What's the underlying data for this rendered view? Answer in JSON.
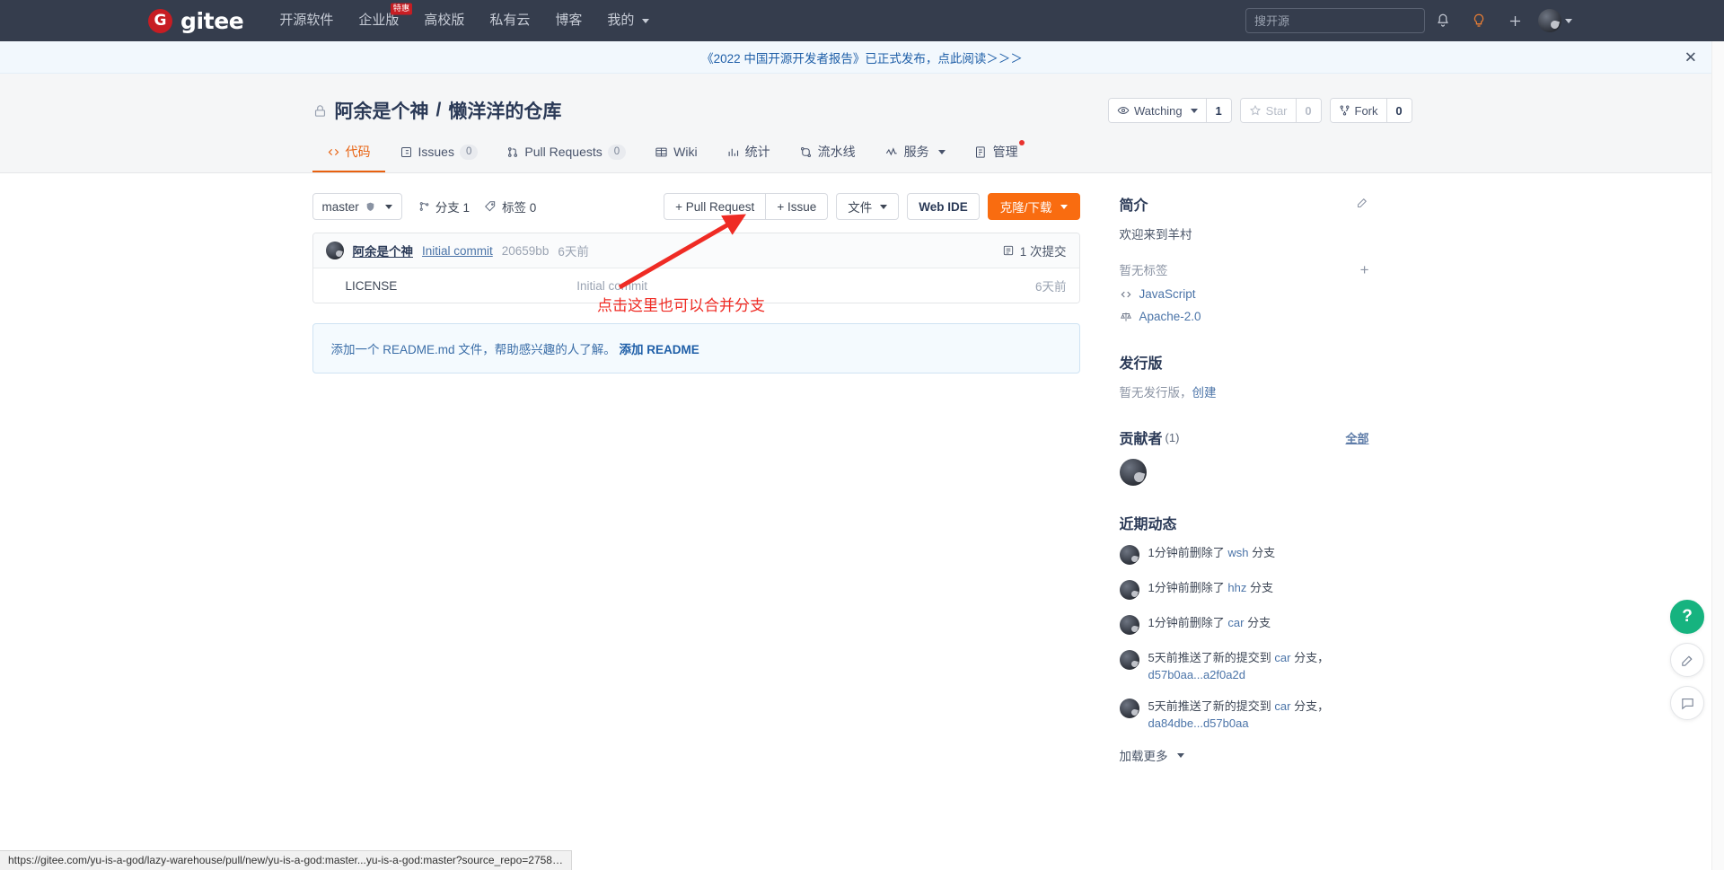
{
  "topnav": {
    "brand": "gitee",
    "logo_letter": "G",
    "links": [
      {
        "label": "开源软件",
        "badge": null
      },
      {
        "label": "企业版",
        "badge": "特惠"
      },
      {
        "label": "高校版",
        "badge": null
      },
      {
        "label": "私有云",
        "badge": null
      },
      {
        "label": "博客",
        "badge": null
      },
      {
        "label": "我的",
        "badge": null,
        "caret": true
      }
    ],
    "search_placeholder": "搜开源",
    "icons": [
      "bell-icon",
      "lightbulb-icon",
      "plus-icon",
      "avatar"
    ],
    "accent_color": "#c71d23",
    "bg_color": "#353d4d"
  },
  "announcement": {
    "text": "《2022 中国开源开发者报告》已正式发布，点此阅读＞＞＞",
    "close_label": "✕"
  },
  "repo": {
    "owner": "阿余是个神",
    "separator": "/",
    "name": "懒洋洋的仓库",
    "visibility_icon": "lock-icon",
    "watch": {
      "label": "Watching",
      "count": "1"
    },
    "star": {
      "label": "Star",
      "count": "0"
    },
    "fork": {
      "label": "Fork",
      "count": "0"
    }
  },
  "tabs": [
    {
      "label": "代码",
      "icon": "code-icon",
      "count": null,
      "active": true
    },
    {
      "label": "Issues",
      "icon": "issue-icon",
      "count": "0",
      "active": false
    },
    {
      "label": "Pull Requests",
      "icon": "pr-icon",
      "count": "0",
      "active": false
    },
    {
      "label": "Wiki",
      "icon": "wiki-icon",
      "count": null,
      "active": false
    },
    {
      "label": "统计",
      "icon": "stats-icon",
      "count": null,
      "active": false
    },
    {
      "label": "流水线",
      "icon": "pipeline-icon",
      "count": null,
      "active": false
    },
    {
      "label": "服务",
      "icon": "service-icon",
      "count": null,
      "active": false,
      "caret": true
    },
    {
      "label": "管理",
      "icon": "manage-icon",
      "count": null,
      "active": false,
      "dot": true
    }
  ],
  "toolbar": {
    "branch": "master",
    "branches_label": "分支 1",
    "tags_label": "标签 0",
    "pull_request_label": "+ Pull Request",
    "issue_label": "+ Issue",
    "files_label": "文件",
    "web_ide_label": "Web IDE",
    "clone_label": "克隆/下载",
    "primary_color": "#f96c10"
  },
  "commit": {
    "author": "阿余是个神",
    "message": "Initial commit",
    "sha": "20659bb",
    "time": "6天前",
    "count_label": "1 次提交"
  },
  "files": [
    {
      "name": "LICENSE",
      "icon": "file-icon",
      "commit_message": "Initial commit",
      "time": "6天前"
    }
  ],
  "readme_tip": {
    "prefix": "添加一个 README.md 文件，帮助感兴趣的人了解。",
    "action": "添加 README"
  },
  "sidebar": {
    "intro": {
      "title": "简介",
      "edit_icon": "edit-icon",
      "description": "欢迎来到羊村",
      "tags_label": "暂无标签",
      "add_tag_icon": "plus-icon",
      "language": "JavaScript",
      "license": "Apache-2.0"
    },
    "releases": {
      "title": "发行版",
      "empty_text": "暂无发行版，",
      "create_link": "创建"
    },
    "contributors": {
      "title": "贡献者",
      "count": "(1)",
      "all_label": "全部"
    },
    "activity": {
      "title": "近期动态",
      "items": [
        {
          "time": "1分钟前",
          "action": "删除了",
          "target": "wsh",
          "suffix": "分支",
          "extra": ""
        },
        {
          "time": "1分钟前",
          "action": "删除了",
          "target": "hhz",
          "suffix": "分支",
          "extra": ""
        },
        {
          "time": "1分钟前",
          "action": "删除了",
          "target": "car",
          "suffix": "分支",
          "extra": ""
        },
        {
          "time": "5天前",
          "action": "推送了新的提交到",
          "target": "car",
          "suffix": "分支，",
          "extra": "d57b0aa...a2f0a2d"
        },
        {
          "time": "5天前",
          "action": "推送了新的提交到",
          "target": "car",
          "suffix": "分支，",
          "extra": "da84dbe...d57b0aa"
        }
      ],
      "load_more": "加载更多"
    }
  },
  "annotation": {
    "text": "点击这里也可以合并分支",
    "color": "#ef2b24"
  },
  "float_widgets": [
    {
      "name": "help-button",
      "glyph": "?"
    },
    {
      "name": "feedback-button",
      "glyph": "edit-icon"
    },
    {
      "name": "chat-button",
      "glyph": "chat-icon"
    }
  ],
  "statusbar": {
    "url": "https://gitee.com/yu-is-a-god/lazy-warehouse/pull/new/yu-is-a-god:master...yu-is-a-god:master?source_repo=2758…"
  }
}
